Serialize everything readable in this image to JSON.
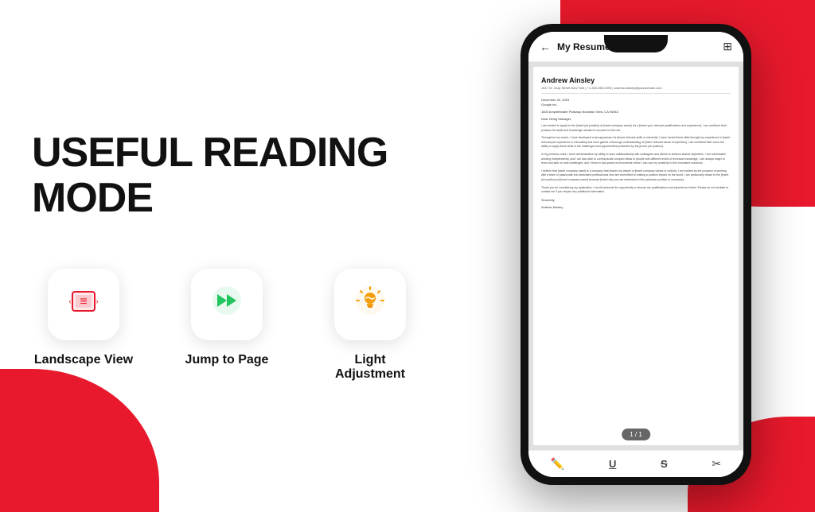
{
  "background": {
    "accent_color": "#e8192c"
  },
  "main_title": "USEFUL READING MODE",
  "features": [
    {
      "id": "landscape-view",
      "label": "Landscape View",
      "icon": "📄",
      "icon_color": "red"
    },
    {
      "id": "jump-to-page",
      "label": "Jump to Page",
      "icon": "⏩",
      "icon_color": "green"
    },
    {
      "id": "light-adjustment",
      "label": "Light Adjustment",
      "icon": "💡",
      "icon_color": "yellow"
    }
  ],
  "phone": {
    "toolbar": {
      "back_label": "←",
      "title": "My Resume.pdf",
      "menu_icon": "⊞"
    },
    "resume": {
      "name": "Andrew Ainsley",
      "contact": "1517 W. Gray Street  New York | +1-300-555-0399 | andrew.ainsley@yourdomain.com",
      "date": "December 30, 2023",
      "company_name": "Google Inc.",
      "company_address": "1600 Amphitheatre Parkway Mountain View, CA 94043",
      "salutation": "Dear Hiring Manager,",
      "paragraphs": [
        "I am excited to apply for the [insert job position] at [insert company name]. As a [insert your relevant qualifications and experience], I am confident that I possess the skills and knowledge needed to succeed in this role.",
        "Throughout my career, I have developed a strong passion for [insert relevant skills or interests]. I have honed these skills through my experience in [insert relevant job experience or education] and have gained a thorough understanding of [insert relevant areas of expertise]. I am confident that I have the ability to apply these skills to the challenges and opportunities presented by the [insert job position].",
        "In my previous roles, I have demonstrated my ability to work collaboratively with colleagues and clients to achieve shared objectives. I am comfortable working independently, and I am also able to communicate complex ideas to people with different levels of technical knowledge. I am always eager to learn and take on new challenges, and I thrive in fast-paced environments where I can use my creativity to find innovative solutions.",
        "I believe that [insert company name] is a company that shares my values of [insert company values or culture]. I am excited by the prospect of working with a team of passionate and dedicated professionals who are committed to making a positive impact on the world. I am particularly drawn to the [insert job position] at [insert company name] because [insert why you are interested in this particular position or company].",
        "Thank you for considering my application. I would welcome the opportunity to discuss my qualifications and experience further. Please do not hesitate to contact me if you require any additional information.",
        "Sincerely,",
        "Andrew Ainsley"
      ]
    },
    "page_indicator": "1 / 1",
    "bottom_icons": [
      "✏️",
      "U̲",
      "S̶",
      "✂️"
    ]
  }
}
